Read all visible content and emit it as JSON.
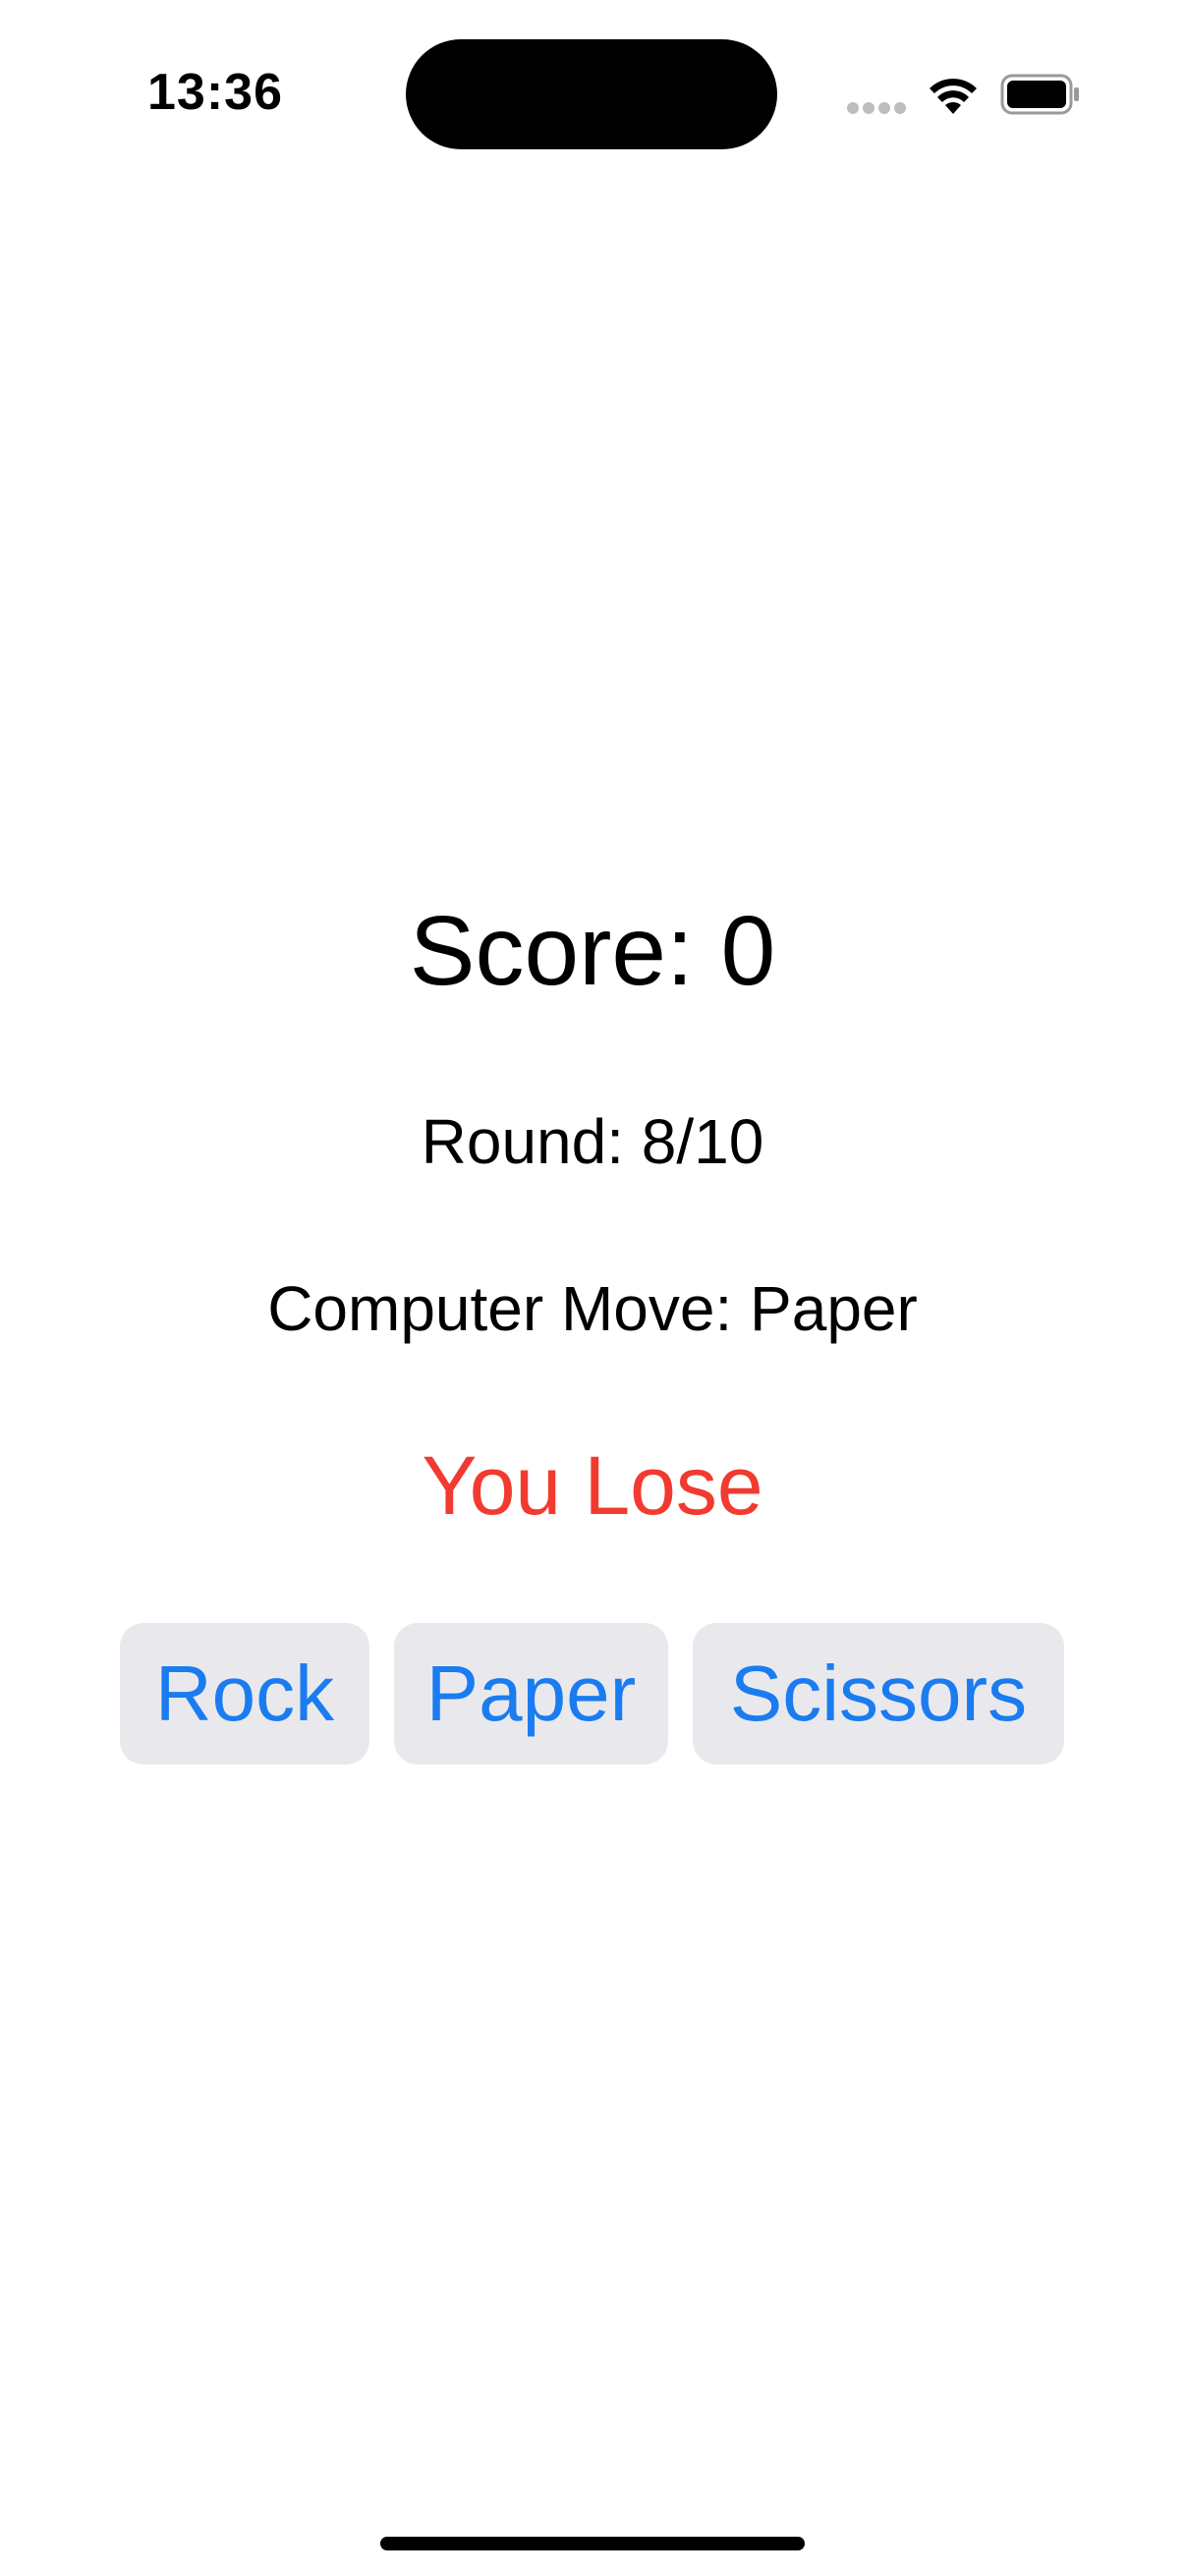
{
  "status_bar": {
    "time": "13:36",
    "icons": [
      "cellular-signal-icon",
      "wifi-icon",
      "battery-icon"
    ]
  },
  "game": {
    "score_text": "Score: 0",
    "round_text": "Round: 8/10",
    "computer_move_text": "Computer Move: Paper",
    "result_text": "You Lose",
    "result_color": "#f13a30",
    "buttons": {
      "rock": "Rock",
      "paper": "Paper",
      "scissors": "Scissors"
    },
    "button_text_color": "#1a7cf0",
    "button_bg_color": "#e9e9ed"
  }
}
